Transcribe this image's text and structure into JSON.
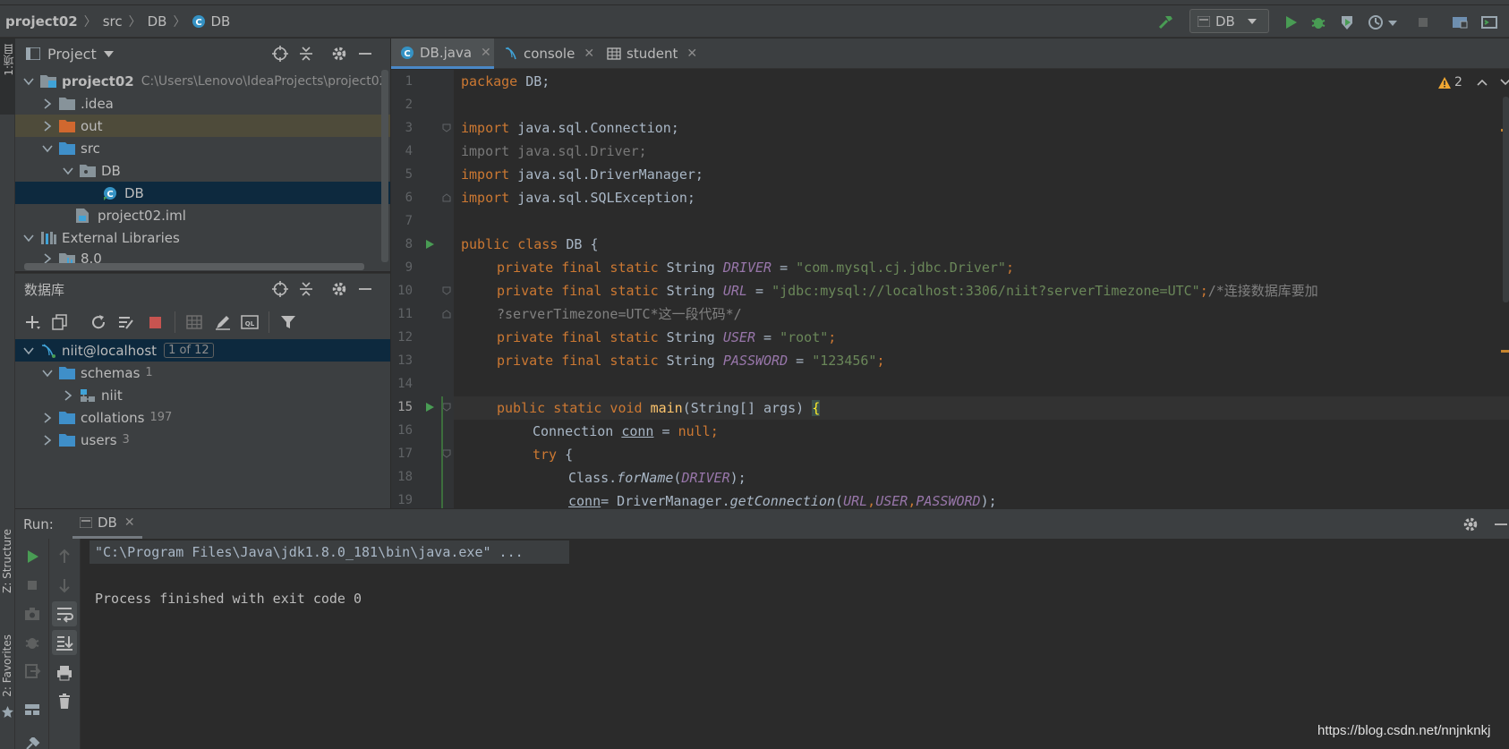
{
  "breadcrumb": {
    "project": "project02",
    "src": "src",
    "pkg": "DB",
    "cls": "DB"
  },
  "toolbar": {
    "run_config": "DB"
  },
  "left_strip": {
    "project_tab": "1:项目",
    "structure_tab": "Z: Structure",
    "favorites_tab": "2: Favorites"
  },
  "project_panel": {
    "title": "Project",
    "tree": [
      {
        "label": "project02",
        "hint": "C:\\Users\\Lenovo\\IdeaProjects\\project02"
      },
      {
        "label": ".idea"
      },
      {
        "label": "out"
      },
      {
        "label": "src"
      },
      {
        "label": "DB"
      },
      {
        "label": "DB"
      },
      {
        "label": "project02.iml"
      },
      {
        "label": "External Libraries"
      },
      {
        "label": "8.0"
      }
    ]
  },
  "db_panel": {
    "title": "数据库",
    "tree": [
      {
        "label": "niit@localhost",
        "badge": "1 of 12"
      },
      {
        "label": "schemas",
        "count": "1"
      },
      {
        "label": "niit"
      },
      {
        "label": "collations",
        "count": "197"
      },
      {
        "label": "users",
        "count": "3"
      }
    ]
  },
  "editor": {
    "tabs": [
      {
        "label": "DB.java"
      },
      {
        "label": "console"
      },
      {
        "label": "student"
      }
    ],
    "warning_count": "2",
    "lines": [
      "1",
      "2",
      "3",
      "4",
      "5",
      "6",
      "7",
      "8",
      "9",
      "10",
      "11",
      "12",
      "13",
      "14",
      "15",
      "16",
      "17",
      "18",
      "19"
    ],
    "code": {
      "l1a": "package",
      "l1b": " DB;",
      "l3a": "import",
      "l3b": " java.sql.Connection;",
      "l4": "import java.sql.Driver;",
      "l5a": "import",
      "l5b": " java.sql.DriverManager;",
      "l6a": "import",
      "l6b": " java.sql.SQLException;",
      "l8a": "public class",
      "l8b": " DB {",
      "mod": "private final static",
      "type": " String ",
      "eq": " = ",
      "semi": ";",
      "l9c": "DRIVER",
      "l9s": "\"com.mysql.cj.jdbc.Driver\"",
      "l10c": "URL",
      "l10s": "\"jdbc:mysql://localhost:3306/niit?serverTimezone=UTC\"",
      "l10m": "/*连接数据库要加",
      "l11": "?serverTimezone=UTC*这一段代码*/",
      "l12c": "USER",
      "l12s": "\"root\"",
      "l13c": "PASSWORD",
      "l13s": "\"123456\"",
      "l15a": "public static void",
      "l15b": " main",
      "l15c": "(String[] args) ",
      "l15d": "{",
      "l16a": "Connection ",
      "l16b": "conn",
      "l16c": " = ",
      "l16d": "null",
      "l16e": ";",
      "l17a": "try",
      "l17b": " {",
      "l18a": "Class.",
      "l18b": "forName",
      "l18c": "(",
      "l18d": "DRIVER",
      "l18e": ");",
      "l19a": "conn",
      "l19b": "= DriverManager.",
      "l19c": "getConnection",
      "l19d": "(",
      "l19e": "URL",
      "l19f": ",",
      "l19g": "USER",
      "l19h": ",",
      "l19i": "PASSWORD",
      "l19j": ");"
    }
  },
  "run_panel": {
    "title": "Run:",
    "tab": "DB",
    "output_cmd": "\"C:\\Program Files\\Java\\jdk1.8.0_181\\bin\\java.exe\" ...",
    "output_exit": "Process finished with exit code 0"
  },
  "watermark": "https://blog.csdn.net/nnjnknkj",
  "colors": {
    "bg": "#2b2b2b",
    "panel": "#3c3f41",
    "selection": "#0d293e",
    "keyword": "#cc7832",
    "string": "#6a8759",
    "constant": "#9876aa"
  }
}
